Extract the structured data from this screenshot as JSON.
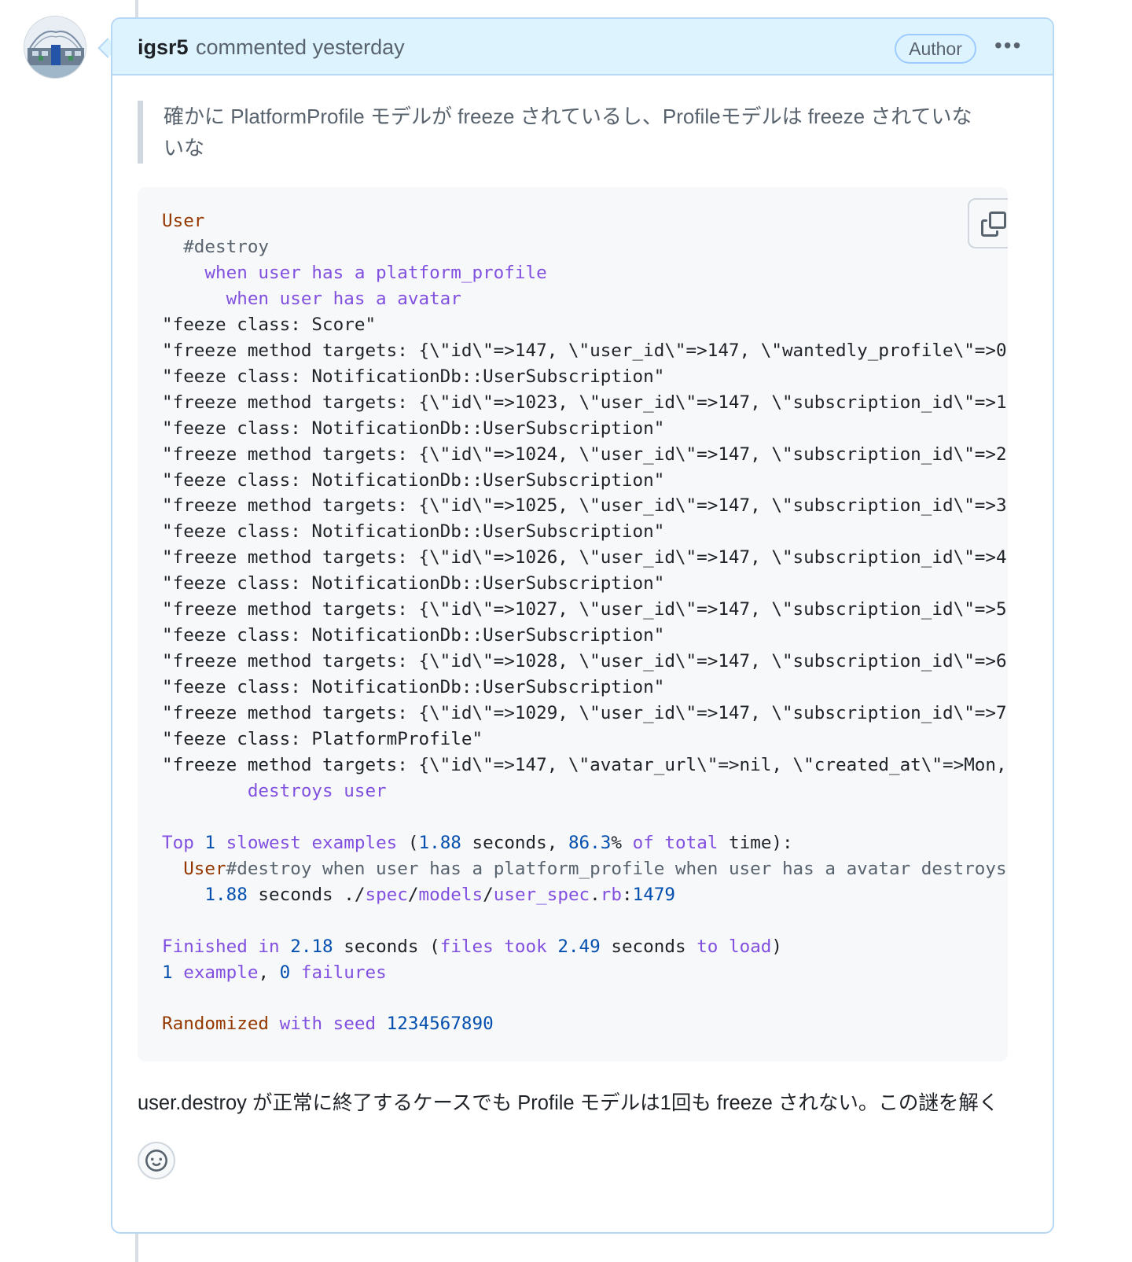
{
  "comment": {
    "author": "igsr5",
    "meta": "commented yesterday",
    "badge": "Author",
    "menu_icon": "kebab-horizontal-icon",
    "quote": "確かに PlatformProfile モデルが freeze されているし、Profileモデルは freeze されていないな",
    "code_lines": [
      {
        "segments": [
          {
            "t": "User",
            "c": "brown"
          }
        ]
      },
      {
        "segments": [
          {
            "t": "  #destroy",
            "c": "gray"
          }
        ]
      },
      {
        "segments": [
          {
            "t": "    when user has a platform_profile",
            "c": "purple"
          }
        ]
      },
      {
        "segments": [
          {
            "t": "      when user has a avatar",
            "c": "purple"
          }
        ]
      },
      {
        "segments": [
          {
            "t": "\"feeze class: Score\"",
            "c": "dark"
          }
        ]
      },
      {
        "segments": [
          {
            "t": "\"freeze method targets: {\\\"id\\\"=>147, \\\"user_id\\\"=>147, \\\"wantedly_profile\\\"=>0",
            "c": "dark"
          }
        ]
      },
      {
        "segments": [
          {
            "t": "\"feeze class: NotificationDb::UserSubscription\"",
            "c": "dark"
          }
        ]
      },
      {
        "segments": [
          {
            "t": "\"freeze method targets: {\\\"id\\\"=>1023, \\\"user_id\\\"=>147, \\\"subscription_id\\\"=>1",
            "c": "dark"
          }
        ]
      },
      {
        "segments": [
          {
            "t": "\"feeze class: NotificationDb::UserSubscription\"",
            "c": "dark"
          }
        ]
      },
      {
        "segments": [
          {
            "t": "\"freeze method targets: {\\\"id\\\"=>1024, \\\"user_id\\\"=>147, \\\"subscription_id\\\"=>2",
            "c": "dark"
          }
        ]
      },
      {
        "segments": [
          {
            "t": "\"feeze class: NotificationDb::UserSubscription\"",
            "c": "dark"
          }
        ]
      },
      {
        "segments": [
          {
            "t": "\"freeze method targets: {\\\"id\\\"=>1025, \\\"user_id\\\"=>147, \\\"subscription_id\\\"=>3",
            "c": "dark"
          }
        ]
      },
      {
        "segments": [
          {
            "t": "\"feeze class: NotificationDb::UserSubscription\"",
            "c": "dark"
          }
        ]
      },
      {
        "segments": [
          {
            "t": "\"freeze method targets: {\\\"id\\\"=>1026, \\\"user_id\\\"=>147, \\\"subscription_id\\\"=>4",
            "c": "dark"
          }
        ]
      },
      {
        "segments": [
          {
            "t": "\"feeze class: NotificationDb::UserSubscription\"",
            "c": "dark"
          }
        ]
      },
      {
        "segments": [
          {
            "t": "\"freeze method targets: {\\\"id\\\"=>1027, \\\"user_id\\\"=>147, \\\"subscription_id\\\"=>5",
            "c": "dark"
          }
        ]
      },
      {
        "segments": [
          {
            "t": "\"feeze class: NotificationDb::UserSubscription\"",
            "c": "dark"
          }
        ]
      },
      {
        "segments": [
          {
            "t": "\"freeze method targets: {\\\"id\\\"=>1028, \\\"user_id\\\"=>147, \\\"subscription_id\\\"=>6",
            "c": "dark"
          }
        ]
      },
      {
        "segments": [
          {
            "t": "\"feeze class: NotificationDb::UserSubscription\"",
            "c": "dark"
          }
        ]
      },
      {
        "segments": [
          {
            "t": "\"freeze method targets: {\\\"id\\\"=>1029, \\\"user_id\\\"=>147, \\\"subscription_id\\\"=>7",
            "c": "dark"
          }
        ]
      },
      {
        "segments": [
          {
            "t": "\"feeze class: PlatformProfile\"",
            "c": "dark"
          }
        ]
      },
      {
        "segments": [
          {
            "t": "\"freeze method targets: {\\\"id\\\"=>147, \\\"avatar_url\\\"=>nil, \\\"created_at\\\"=>Mon,",
            "c": "dark"
          }
        ]
      },
      {
        "segments": [
          {
            "t": "        destroys user",
            "c": "purple"
          }
        ]
      },
      {
        "segments": []
      },
      {
        "segments": [
          {
            "t": "Top ",
            "c": "purple"
          },
          {
            "t": "1",
            "c": "blue"
          },
          {
            "t": " slowest examples ",
            "c": "purple"
          },
          {
            "t": "(",
            "c": "dark"
          },
          {
            "t": "1.88",
            "c": "blue"
          },
          {
            "t": " seconds, ",
            "c": "dark"
          },
          {
            "t": "86.3",
            "c": "blue"
          },
          {
            "t": "%",
            "c": "dark"
          },
          {
            "t": " of total ",
            "c": "purple"
          },
          {
            "t": "time):",
            "c": "dark"
          }
        ]
      },
      {
        "segments": [
          {
            "t": "  User",
            "c": "brown"
          },
          {
            "t": "#destroy when user has a platform_profile when user has a avatar destroys",
            "c": "gray"
          }
        ]
      },
      {
        "segments": [
          {
            "t": "    1.88",
            "c": "blue"
          },
          {
            "t": " seconds ./",
            "c": "dark"
          },
          {
            "t": "spec",
            "c": "purple"
          },
          {
            "t": "/",
            "c": "dark"
          },
          {
            "t": "models",
            "c": "purple"
          },
          {
            "t": "/",
            "c": "dark"
          },
          {
            "t": "user_spec",
            "c": "purple"
          },
          {
            "t": ".",
            "c": "dark"
          },
          {
            "t": "rb",
            "c": "purple"
          },
          {
            "t": ":",
            "c": "dark"
          },
          {
            "t": "1479",
            "c": "blue"
          }
        ]
      },
      {
        "segments": []
      },
      {
        "segments": [
          {
            "t": "Finished in ",
            "c": "purple"
          },
          {
            "t": "2.18",
            "c": "blue"
          },
          {
            "t": " seconds (",
            "c": "dark"
          },
          {
            "t": "files took ",
            "c": "purple"
          },
          {
            "t": "2.49",
            "c": "blue"
          },
          {
            "t": " seconds ",
            "c": "dark"
          },
          {
            "t": "to load",
            "c": "purple"
          },
          {
            "t": ")",
            "c": "dark"
          }
        ]
      },
      {
        "segments": [
          {
            "t": "1",
            "c": "blue"
          },
          {
            "t": " example",
            "c": "purple"
          },
          {
            "t": ", ",
            "c": "dark"
          },
          {
            "t": "0",
            "c": "blue"
          },
          {
            "t": " failures",
            "c": "purple"
          }
        ]
      },
      {
        "segments": []
      },
      {
        "segments": [
          {
            "t": "Randomized ",
            "c": "brown"
          },
          {
            "t": "with seed ",
            "c": "purple"
          },
          {
            "t": "1234567890",
            "c": "blue"
          }
        ]
      }
    ],
    "body": "user.destroy が正常に終了するケースでも Profile モデルは1回も freeze されない。この謎を解く",
    "copy_icon": "copy-icon",
    "reaction_icon": "smiley-icon"
  }
}
